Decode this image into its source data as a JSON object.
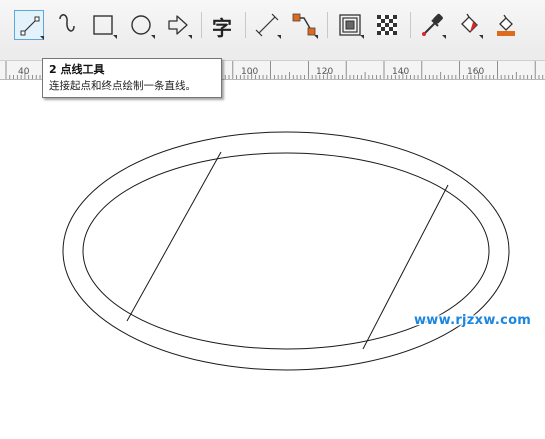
{
  "toolbar": {
    "tools": [
      {
        "id": "2-point-line-tool",
        "icon": "2-point-line-icon",
        "active": true
      },
      {
        "id": "bspline-tool",
        "icon": "bspline-curve-icon"
      },
      {
        "id": "rectangle-tool",
        "icon": "rectangle-icon"
      },
      {
        "id": "ellipse-tool",
        "icon": "ellipse-icon"
      },
      {
        "id": "common-shapes-tool",
        "icon": "arrow-shape-icon"
      },
      {
        "id": "text-tool",
        "icon": "text-icon",
        "glyph": "字"
      },
      {
        "id": "dimension-tool",
        "icon": "dimension-icon"
      },
      {
        "id": "connector-tool",
        "icon": "connector-icon"
      },
      {
        "id": "contour-tool",
        "icon": "contour-icon"
      },
      {
        "id": "transparency-tool",
        "icon": "transparency-icon"
      },
      {
        "id": "eyedropper-tool",
        "icon": "eyedropper-icon"
      },
      {
        "id": "interactive-fill-tool",
        "icon": "fill-bucket-icon"
      },
      {
        "id": "smart-fill-tool",
        "icon": "smart-fill-icon"
      }
    ]
  },
  "ruler": {
    "labels": [
      "40",
      "100",
      "120",
      "140",
      "160"
    ]
  },
  "tooltip": {
    "title": "2 点线工具",
    "description": "连接起点和终点绘制一条直线。"
  },
  "watermark": {
    "text": "www.rjzxw.com",
    "color": "#1a86e0"
  },
  "colors": {
    "accent_blue": "#3a8fd4",
    "icon_orange": "#e06a1b",
    "icon_red": "#d9262a"
  }
}
